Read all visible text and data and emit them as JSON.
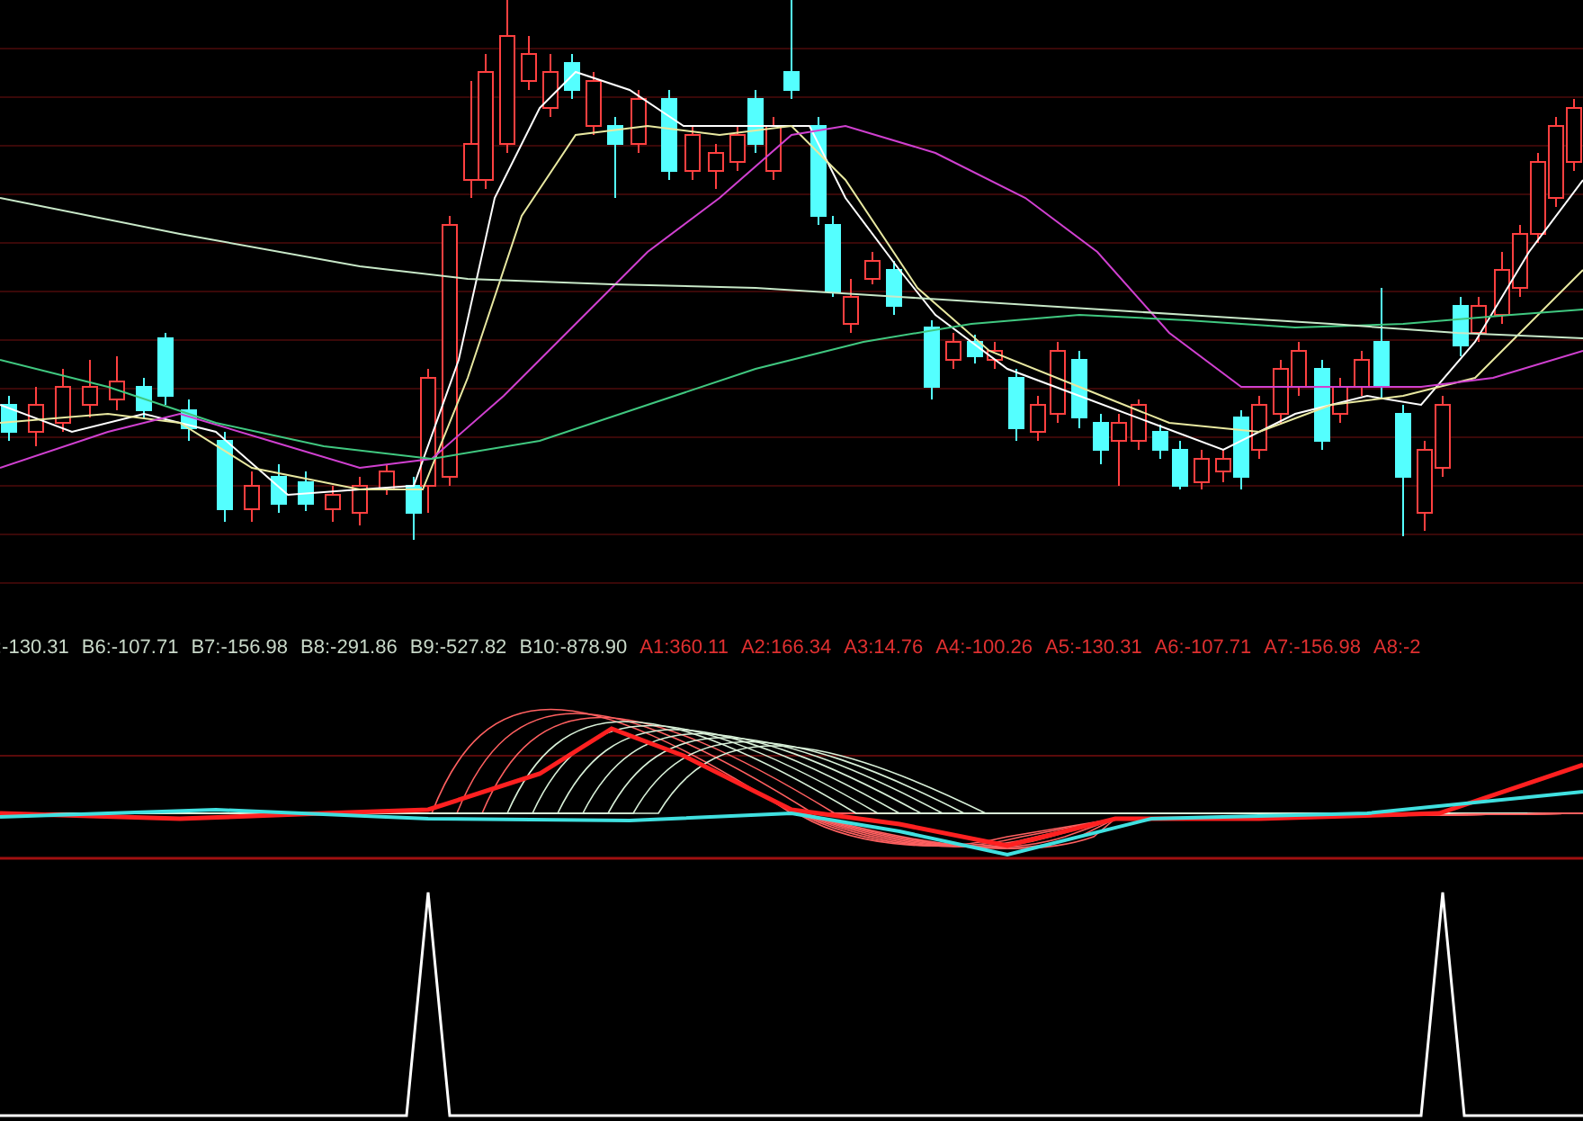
{
  "indicator_legend": [
    {
      "text": ":-130.31",
      "color": "#c8d8c8"
    },
    {
      "text": "B6:-107.71",
      "color": "#c8d8c8"
    },
    {
      "text": "B7:-156.98",
      "color": "#c8d8c8"
    },
    {
      "text": "B8:-291.86",
      "color": "#c8d8c8"
    },
    {
      "text": "B9:-527.82",
      "color": "#c8d8c8"
    },
    {
      "text": "B10:-878.90",
      "color": "#c8d8c8"
    },
    {
      "text": "A1:360.11",
      "color": "#e03030"
    },
    {
      "text": "A2:166.34",
      "color": "#e03030"
    },
    {
      "text": "A3:14.76",
      "color": "#e03030"
    },
    {
      "text": "A4:-100.26",
      "color": "#e03030"
    },
    {
      "text": "A5:-130.31",
      "color": "#e03030"
    },
    {
      "text": "A6:-107.71",
      "color": "#e03030"
    },
    {
      "text": "A7:-156.98",
      "color": "#e03030"
    },
    {
      "text": "A8:-2",
      "color": "#e03030"
    }
  ]
}
